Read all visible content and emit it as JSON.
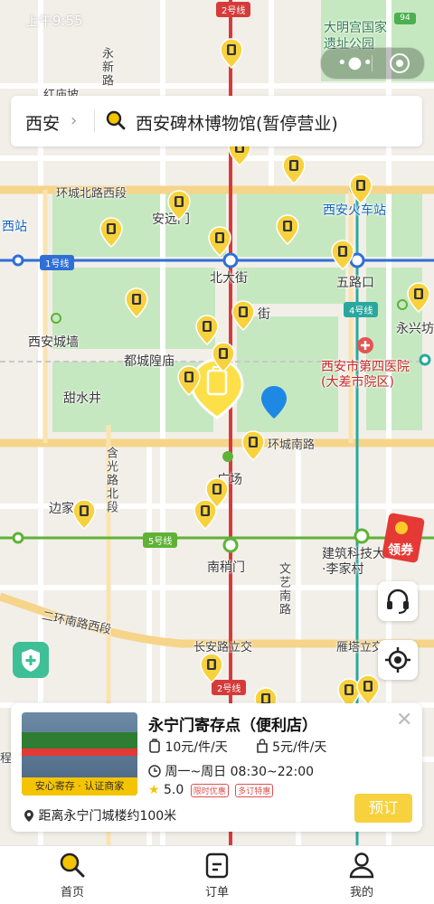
{
  "status_bar": {
    "time": "上午9:55",
    "battery": "94"
  },
  "capsule": {
    "more_icon": "more-dots-icon",
    "close_icon": "target-close-icon"
  },
  "search": {
    "city": "西安",
    "query": "西安碑林博物馆(暂停营业)"
  },
  "map": {
    "places": {
      "daming": "大明宫国家\n遗址公园",
      "xian_station": "西安火车站",
      "xian_west_station": "西站",
      "anyuanmen": "安远门",
      "beidajie": "北大街",
      "wulukou": "五路口",
      "yongxingfang": "永兴坊",
      "xian_wall": "西安城墙",
      "duchenghuang": "都城隍庙",
      "hospital": "西安市第四医院\n(大差市院区)",
      "tianshuijing": "甜水井",
      "nanshaomen": "南稍门",
      "jianzhu": "建筑科技大\n·李家村",
      "bianjia": "边家",
      "guangchang": "广场",
      "jie": "街"
    },
    "roads": {
      "yongxinlu": "永新路",
      "qiaopao": "红庙坡",
      "huanchengbei": "环城北路西段",
      "huanchengnan": "环城南路",
      "hanguang": "含光路北段",
      "wenyi": "文艺南路",
      "erhuan": "二环南路西段",
      "changan": "长安路立交",
      "yanta": "雁塔立交",
      "ke": "程"
    },
    "metro": {
      "line1": "1号线",
      "line2": "2号线",
      "line4": "4号线",
      "line5": "5号线"
    },
    "colors": {
      "line1": "#2f6fd6",
      "line2": "#d63b3b",
      "line4": "#2aa8a0",
      "line5": "#5fb236",
      "park": "#c6e8c0"
    }
  },
  "coupon": {
    "label": "领券"
  },
  "card": {
    "title": "永宁门寄存点（便利店）",
    "verify": "安心寄存 · 认证商家",
    "price_large": "10元/件/天",
    "price_small": "5元/件/天",
    "hours": "周一~周日 08:30~22:00",
    "rating": "5.0",
    "tag1": "限时优惠",
    "tag2": "多订特惠",
    "distance": "距离永宁门城楼约100米",
    "book": "预订"
  },
  "tabs": [
    {
      "label": "首页",
      "icon": "search-icon"
    },
    {
      "label": "订单",
      "icon": "order-icon"
    },
    {
      "label": "我的",
      "icon": "user-icon"
    }
  ]
}
